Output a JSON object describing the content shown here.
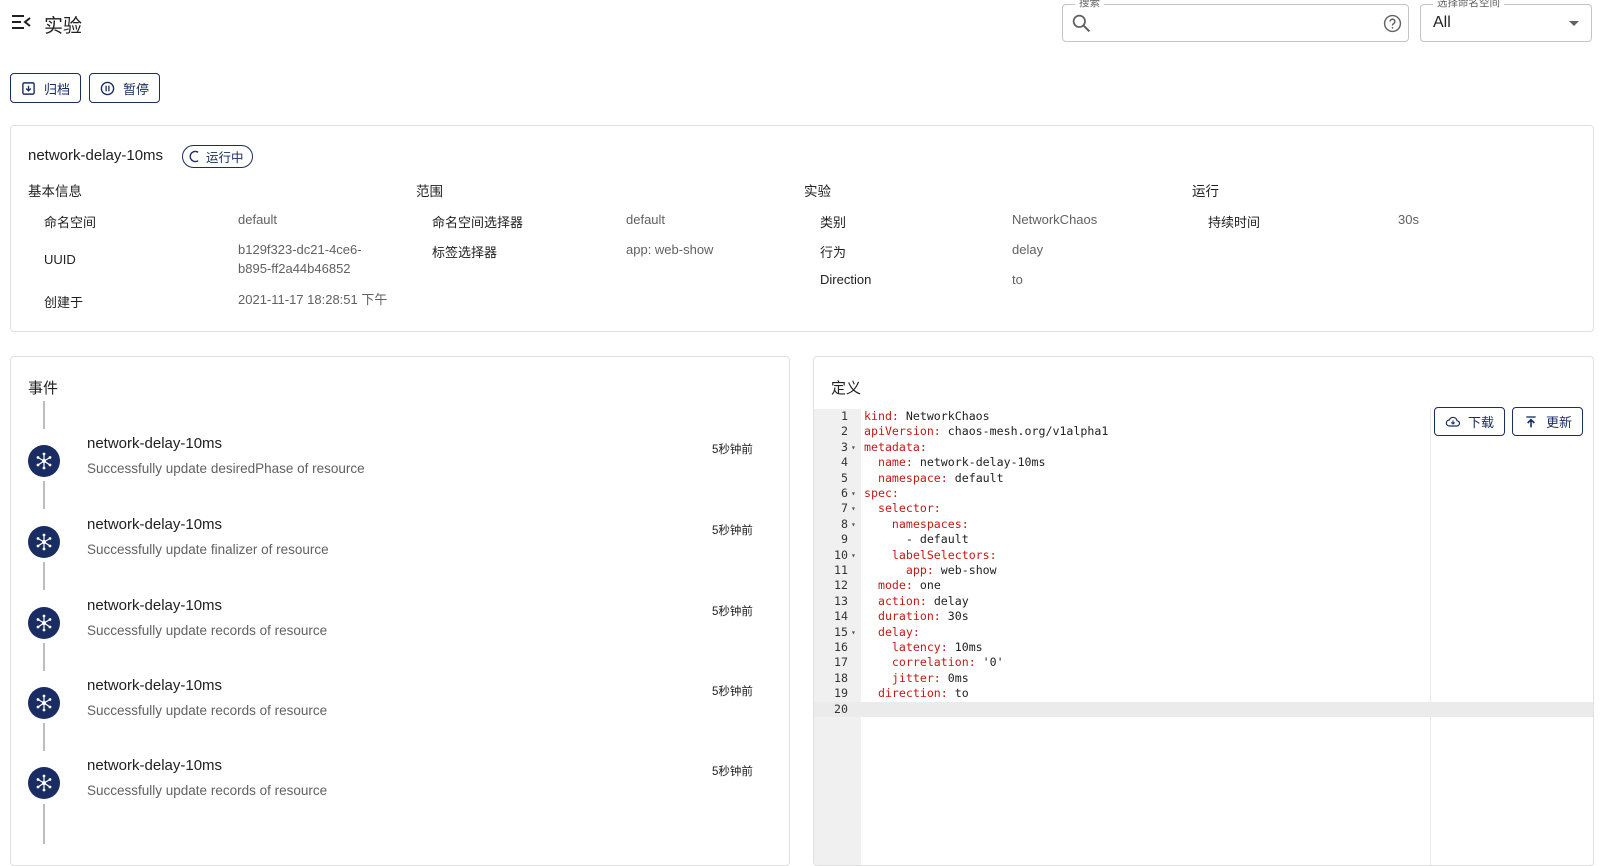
{
  "header": {
    "title": "实验",
    "search_label": "搜索",
    "search_value": "",
    "namespace_label": "选择命名空间",
    "namespace_value": "All"
  },
  "toolbar": {
    "archive_label": "归档",
    "pause_label": "暂停"
  },
  "experiment": {
    "name": "network-delay-10ms",
    "status": "运行中",
    "sections": {
      "basic": "基本信息",
      "scope": "范围",
      "experiment": "实验",
      "run": "运行"
    },
    "basic": {
      "namespace_label": "命名空间",
      "namespace_value": "default",
      "uuid_label": "UUID",
      "uuid_value_1": "b129f323-dc21-4ce6-",
      "uuid_value_2": "b895-ff2a44b46852",
      "created_label": "创建于",
      "created_value": "2021-11-17 18:28:51 下午"
    },
    "scope": {
      "ns_selector_label": "命名空间选择器",
      "ns_selector_value": "default",
      "label_selector_label": "标签选择器",
      "label_selector_value": "app: web-show"
    },
    "exp": {
      "kind_label": "类别",
      "kind_value": "NetworkChaos",
      "action_label": "行为",
      "action_value": "delay",
      "direction_label": "Direction",
      "direction_value": "to"
    },
    "run": {
      "duration_label": "持续时间",
      "duration_value": "30s"
    }
  },
  "events": {
    "title": "事件",
    "items": [
      {
        "name": "network-delay-10ms",
        "message": "Successfully update desiredPhase of resource",
        "time": "5秒钟前"
      },
      {
        "name": "network-delay-10ms",
        "message": "Successfully update finalizer of resource",
        "time": "5秒钟前"
      },
      {
        "name": "network-delay-10ms",
        "message": "Successfully update records of resource",
        "time": "5秒钟前"
      },
      {
        "name": "network-delay-10ms",
        "message": "Successfully update records of resource",
        "time": "5秒钟前"
      },
      {
        "name": "network-delay-10ms",
        "message": "Successfully update records of resource",
        "time": "5秒钟前"
      }
    ]
  },
  "definition": {
    "title": "定义",
    "download_label": "下载",
    "update_label": "更新",
    "lines": [
      {
        "n": "1",
        "fold": "",
        "indent": "",
        "key": "kind:",
        "val": " NetworkChaos"
      },
      {
        "n": "2",
        "fold": "",
        "indent": "",
        "key": "apiVersion:",
        "val": " chaos-mesh.org/v1alpha1"
      },
      {
        "n": "3",
        "fold": "▾",
        "indent": "",
        "key": "metadata:",
        "val": ""
      },
      {
        "n": "4",
        "fold": "",
        "indent": "  ",
        "key": "name:",
        "val": " network-delay-10ms"
      },
      {
        "n": "5",
        "fold": "",
        "indent": "  ",
        "key": "namespace:",
        "val": " default"
      },
      {
        "n": "6",
        "fold": "▾",
        "indent": "",
        "key": "spec:",
        "val": ""
      },
      {
        "n": "7",
        "fold": "▾",
        "indent": "  ",
        "key": "selector:",
        "val": ""
      },
      {
        "n": "8",
        "fold": "▾",
        "indent": "    ",
        "key": "namespaces:",
        "val": ""
      },
      {
        "n": "9",
        "fold": "",
        "indent": "    ",
        "key": "",
        "val": "  - default"
      },
      {
        "n": "10",
        "fold": "▾",
        "indent": "    ",
        "key": "labelSelectors:",
        "val": ""
      },
      {
        "n": "11",
        "fold": "",
        "indent": "      ",
        "key": "app:",
        "val": " web-show"
      },
      {
        "n": "12",
        "fold": "",
        "indent": "  ",
        "key": "mode:",
        "val": " one"
      },
      {
        "n": "13",
        "fold": "",
        "indent": "  ",
        "key": "action:",
        "val": " delay"
      },
      {
        "n": "14",
        "fold": "",
        "indent": "  ",
        "key": "duration:",
        "val": " 30s"
      },
      {
        "n": "15",
        "fold": "▾",
        "indent": "  ",
        "key": "delay:",
        "val": ""
      },
      {
        "n": "16",
        "fold": "",
        "indent": "    ",
        "key": "latency:",
        "val": " 10ms"
      },
      {
        "n": "17",
        "fold": "",
        "indent": "    ",
        "key": "correlation:",
        "val": " '0'"
      },
      {
        "n": "18",
        "fold": "",
        "indent": "    ",
        "key": "jitter:",
        "val": " 0ms"
      },
      {
        "n": "19",
        "fold": "",
        "indent": "  ",
        "key": "direction:",
        "val": " to"
      },
      {
        "n": "20",
        "fold": "",
        "indent": "",
        "key": "",
        "val": ""
      }
    ]
  },
  "colors": {
    "primary": "#1a2d62",
    "yaml_key": "#c41a16"
  }
}
